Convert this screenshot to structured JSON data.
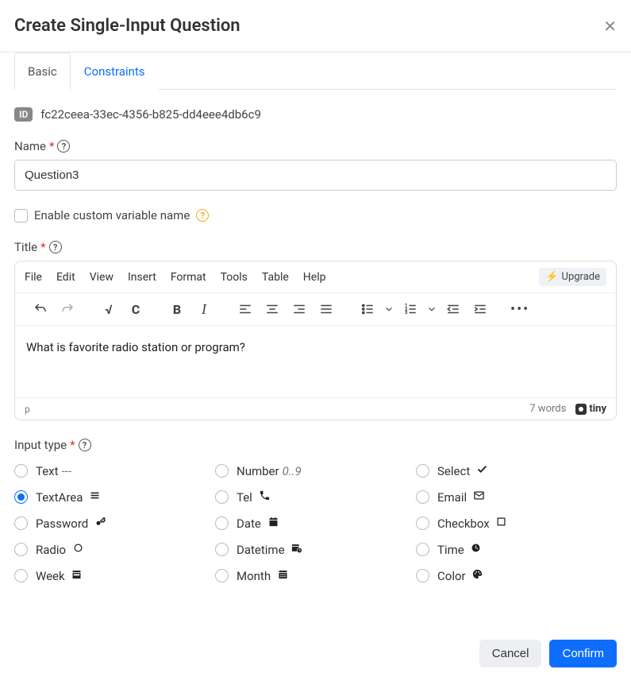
{
  "header": {
    "title": "Create Single-Input Question"
  },
  "tabs": {
    "basic": "Basic",
    "constraints": "Constraints"
  },
  "id_section": {
    "badge": "ID",
    "value": "fc22ceea-33ec-4356-b825-dd4eee4db6c9"
  },
  "name_field": {
    "label": "Name",
    "value": "Question3"
  },
  "custom_var_checkbox": {
    "label": "Enable custom variable name"
  },
  "title_field": {
    "label": "Title"
  },
  "editor": {
    "menus": {
      "file": "File",
      "edit": "Edit",
      "view": "View",
      "insert": "Insert",
      "format": "Format",
      "tools": "Tools",
      "table": "Table",
      "help": "Help"
    },
    "upgrade": "Upgrade",
    "content": "What is favorite radio station or program?",
    "status_path": "p",
    "word_count": "7 words",
    "brand": "tiny"
  },
  "input_type_field": {
    "label": "Input type"
  },
  "input_types": {
    "text": {
      "label": "Text",
      "hint": "---"
    },
    "number": {
      "label": "Number",
      "hint": "0..9"
    },
    "select": {
      "label": "Select"
    },
    "textarea": {
      "label": "TextArea"
    },
    "tel": {
      "label": "Tel"
    },
    "email": {
      "label": "Email"
    },
    "password": {
      "label": "Password"
    },
    "date": {
      "label": "Date"
    },
    "checkbox": {
      "label": "Checkbox"
    },
    "radio": {
      "label": "Radio"
    },
    "datetime": {
      "label": "Datetime"
    },
    "time": {
      "label": "Time"
    },
    "week": {
      "label": "Week"
    },
    "month": {
      "label": "Month"
    },
    "color": {
      "label": "Color"
    }
  },
  "footer": {
    "cancel": "Cancel",
    "confirm": "Confirm"
  }
}
